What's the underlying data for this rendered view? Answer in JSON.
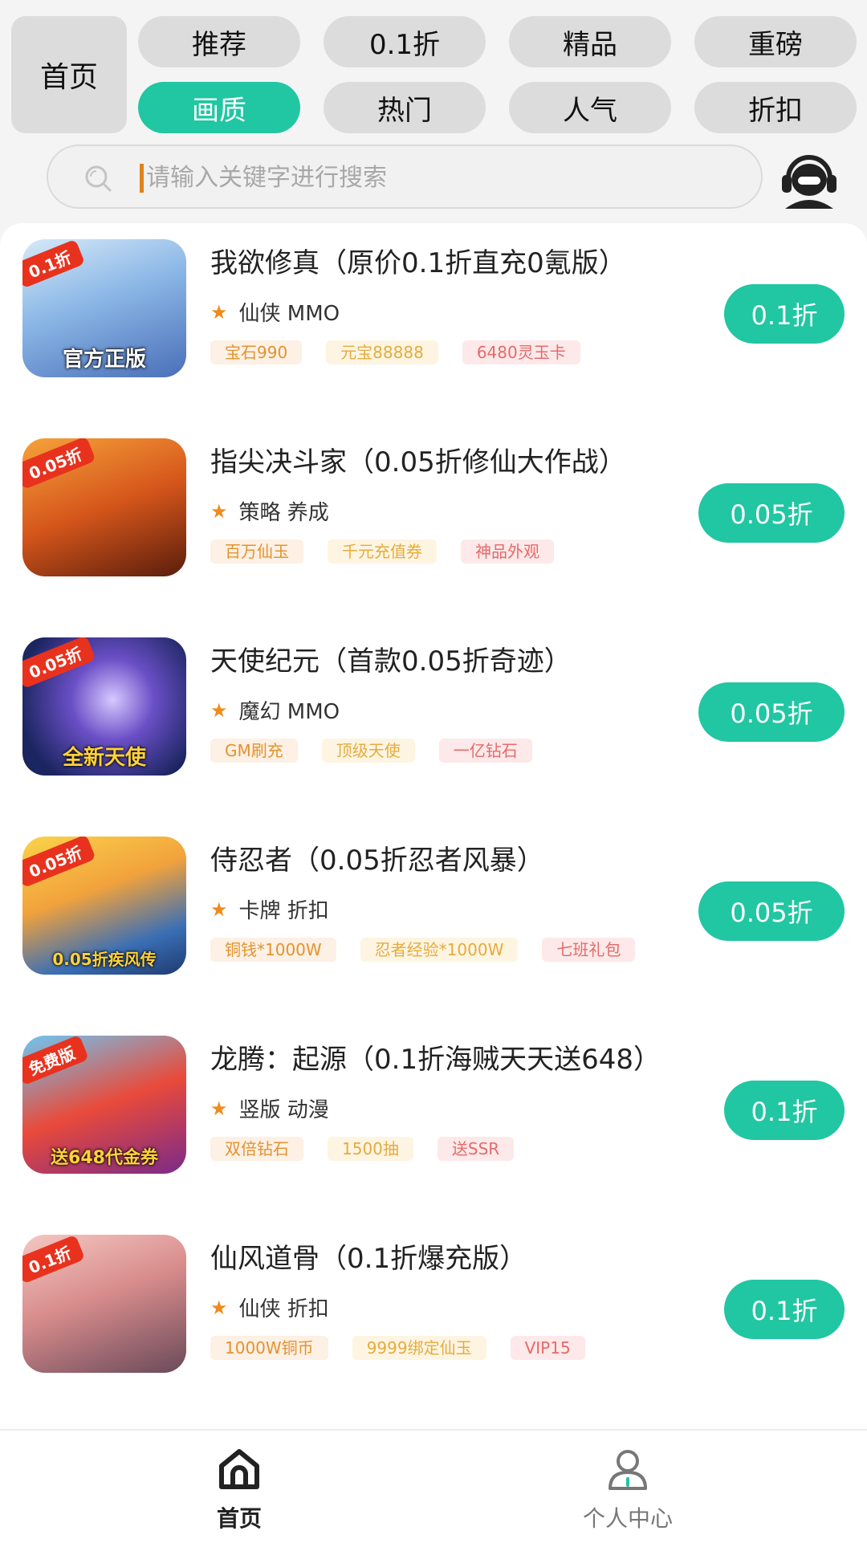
{
  "top": {
    "home": "首页",
    "categories": [
      {
        "label": "推荐"
      },
      {
        "label": "0.1折"
      },
      {
        "label": "精品"
      },
      {
        "label": "重磅"
      },
      {
        "label": "画质"
      },
      {
        "label": "热门"
      },
      {
        "label": "人气"
      },
      {
        "label": "折扣"
      }
    ],
    "active_category": "画质",
    "accent_color": "#21c6a2"
  },
  "search": {
    "placeholder": "请输入关键字进行搜索",
    "icon": "search-icon",
    "support_icon": "customer-service-icon"
  },
  "games": [
    {
      "title": "我欲修真（原价0.1折直充0氪版）",
      "genre": "仙侠 MMO",
      "tags": [
        "宝石990",
        "元宝88888",
        "6480灵玉卡"
      ],
      "price": "0.1折",
      "thumb_badge": "0.1折",
      "thumb_caption": "官方正版"
    },
    {
      "title": "指尖决斗家（0.05折修仙大作战）",
      "genre": "策略 养成",
      "tags": [
        "百万仙玉",
        "千元充值券",
        "神品外观"
      ],
      "price": "0.05折",
      "thumb_badge": "0.05折",
      "thumb_caption": ""
    },
    {
      "title": "天使纪元（首款0.05折奇迹）",
      "genre": "魔幻 MMO",
      "tags": [
        "GM刷充",
        "顶级天使",
        "一亿钻石"
      ],
      "price": "0.05折",
      "thumb_badge": "0.05折",
      "thumb_caption": "全新天使"
    },
    {
      "title": "侍忍者（0.05折忍者风暴）",
      "genre": "卡牌 折扣",
      "tags": [
        "铜钱*1000W",
        "忍者经验*1000W",
        "七班礼包"
      ],
      "price": "0.05折",
      "thumb_badge": "0.05折",
      "thumb_caption": "0.05折疾风传"
    },
    {
      "title": "龙腾：起源（0.1折海贼天天送648）",
      "genre": "竖版 动漫",
      "tags": [
        "双倍钻石",
        "1500抽",
        "送SSR"
      ],
      "price": "0.1折",
      "thumb_badge": "免费版",
      "thumb_caption": "送648代金券"
    },
    {
      "title": "仙风道骨（0.1折爆充版）",
      "genre": "仙侠 折扣",
      "tags": [
        "1000W铜币",
        "9999绑定仙玉",
        "VIP15"
      ],
      "price": "0.1折",
      "thumb_badge": "0.1折",
      "thumb_caption": ""
    }
  ],
  "bottom_nav": [
    {
      "label": "首页",
      "icon": "home-icon",
      "active": true
    },
    {
      "label": "个人中心",
      "icon": "user-icon",
      "active": false
    }
  ]
}
